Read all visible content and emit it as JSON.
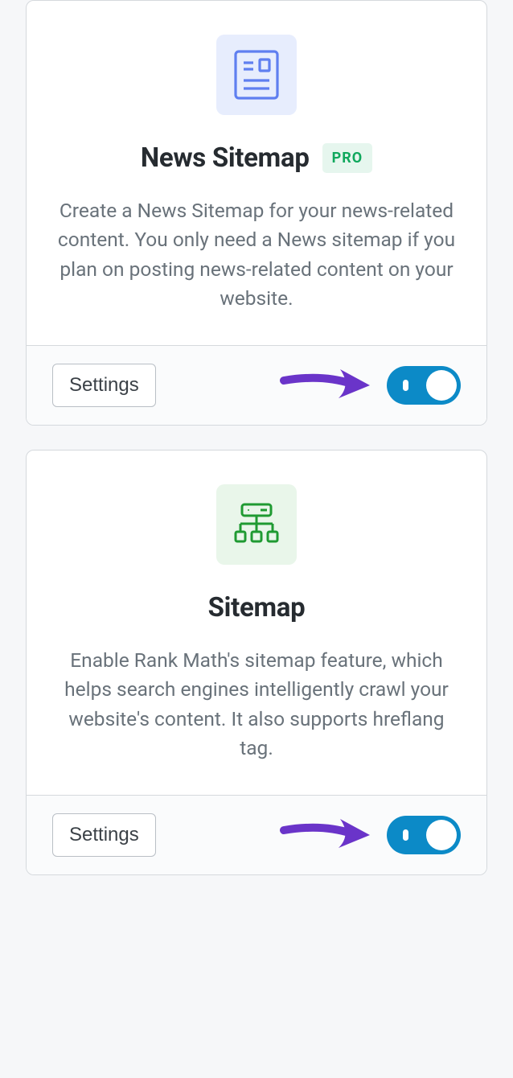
{
  "cards": [
    {
      "title": "News Sitemap",
      "badge": "PRO",
      "desc": "Create a News Sitemap for your news-related content. You only need a News sitemap if you plan on posting news-related content on your website.",
      "settings_label": "Settings",
      "toggle_on": true
    },
    {
      "title": "Sitemap",
      "badge": "",
      "desc": "Enable Rank Math's sitemap feature, which helps search engines intelligently crawl your website's content. It also supports hreflang tag.",
      "settings_label": "Settings",
      "toggle_on": true
    }
  ]
}
